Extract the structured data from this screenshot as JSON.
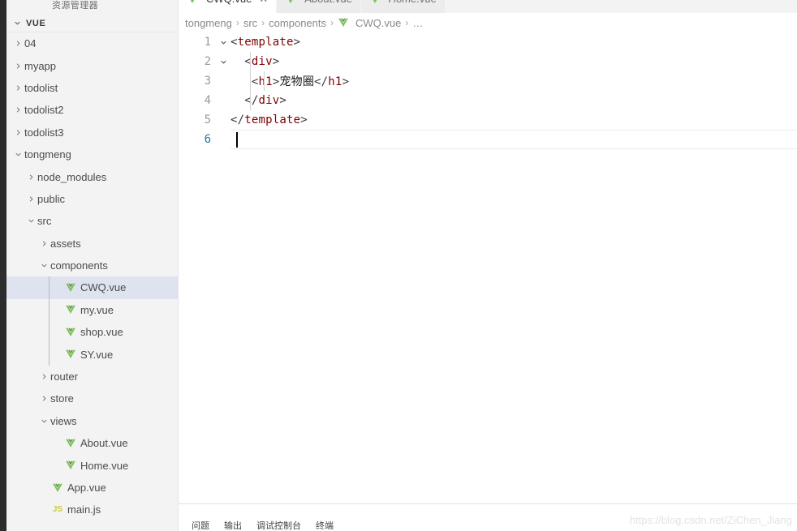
{
  "colors": {
    "activity_bar": "#2d2d2d",
    "sidebar_bg": "#f3f3f3",
    "selection": "#dfe2ef",
    "tab_inactive": "#ececec",
    "tab_active": "#ffffff",
    "vue_green": "#41b883",
    "vue_green_dark": "#80c25b",
    "js_yellow": "#cbcb41",
    "tag_name": "#800000",
    "line_number_active": "#237893"
  },
  "sidebar": {
    "title": "资源管理器",
    "section": {
      "label": "VUE",
      "twisty": "chevron-down-icon"
    },
    "items": [
      {
        "label": "04",
        "depth": 1,
        "twisty": "chevron-right-icon",
        "icon": "none",
        "selected": false
      },
      {
        "label": "myapp",
        "depth": 1,
        "twisty": "chevron-right-icon",
        "icon": "none",
        "selected": false
      },
      {
        "label": "todolist",
        "depth": 1,
        "twisty": "chevron-right-icon",
        "icon": "none",
        "selected": false
      },
      {
        "label": "todolist2",
        "depth": 1,
        "twisty": "chevron-right-icon",
        "icon": "none",
        "selected": false
      },
      {
        "label": "todolist3",
        "depth": 1,
        "twisty": "chevron-right-icon",
        "icon": "none",
        "selected": false
      },
      {
        "label": "tongmeng",
        "depth": 1,
        "twisty": "chevron-down-icon",
        "icon": "none",
        "selected": false
      },
      {
        "label": "node_modules",
        "depth": 2,
        "twisty": "chevron-right-icon",
        "icon": "none",
        "selected": false
      },
      {
        "label": "public",
        "depth": 2,
        "twisty": "chevron-right-icon",
        "icon": "none",
        "selected": false
      },
      {
        "label": "src",
        "depth": 2,
        "twisty": "chevron-down-icon",
        "icon": "none",
        "selected": false
      },
      {
        "label": "assets",
        "depth": 3,
        "twisty": "chevron-right-icon",
        "icon": "none",
        "selected": false
      },
      {
        "label": "components",
        "depth": 3,
        "twisty": "chevron-down-icon",
        "icon": "none",
        "selected": false
      },
      {
        "label": "CWQ.vue",
        "depth": 4,
        "twisty": "none",
        "icon": "vue-file-icon",
        "selected": true
      },
      {
        "label": "my.vue",
        "depth": 4,
        "twisty": "none",
        "icon": "vue-file-icon",
        "selected": false
      },
      {
        "label": "shop.vue",
        "depth": 4,
        "twisty": "none",
        "icon": "vue-file-icon",
        "selected": false
      },
      {
        "label": "SY.vue",
        "depth": 4,
        "twisty": "none",
        "icon": "vue-file-icon",
        "selected": false
      },
      {
        "label": "router",
        "depth": 3,
        "twisty": "chevron-right-icon",
        "icon": "none",
        "selected": false
      },
      {
        "label": "store",
        "depth": 3,
        "twisty": "chevron-right-icon",
        "icon": "none",
        "selected": false
      },
      {
        "label": "views",
        "depth": 3,
        "twisty": "chevron-down-icon",
        "icon": "none",
        "selected": false
      },
      {
        "label": "About.vue",
        "depth": 4,
        "twisty": "none",
        "icon": "vue-file-icon",
        "selected": false
      },
      {
        "label": "Home.vue",
        "depth": 4,
        "twisty": "none",
        "icon": "vue-file-icon",
        "selected": false
      },
      {
        "label": "App.vue",
        "depth": 3,
        "twisty": "none",
        "icon": "vue-file-icon",
        "selected": false
      },
      {
        "label": "main.js",
        "depth": 3,
        "twisty": "none",
        "icon": "js-file-icon",
        "selected": false
      }
    ]
  },
  "editor": {
    "tabs": [
      {
        "label": "CWQ.vue",
        "icon": "vue-file-icon",
        "active": true,
        "preview": false,
        "closable": true,
        "close_glyph": "✕"
      },
      {
        "label": "About.vue",
        "icon": "vue-file-icon",
        "active": false,
        "preview": false,
        "closable": false
      },
      {
        "label": "Home.vue",
        "icon": "vue-file-icon",
        "active": false,
        "preview": true,
        "closable": false
      }
    ],
    "breadcrumb": {
      "separator": "›",
      "crumbs": [
        "tongmeng",
        "src",
        "components"
      ],
      "file": "CWQ.vue",
      "file_icon": "vue-file-icon",
      "trailing": "…"
    },
    "lines": [
      {
        "num": "1",
        "fold": "chevron-down-icon",
        "indent": 0,
        "segments": [
          {
            "t": "<",
            "c": "tagbr"
          },
          {
            "t": "template",
            "c": "tagname"
          },
          {
            "t": ">",
            "c": "tagbr"
          }
        ]
      },
      {
        "num": "2",
        "fold": "chevron-down-icon",
        "indent": 2,
        "segments": [
          {
            "t": "  <",
            "c": "tagbr"
          },
          {
            "t": "div",
            "c": "tagname"
          },
          {
            "t": ">",
            "c": "tagbr"
          }
        ]
      },
      {
        "num": "3",
        "fold": "none",
        "indent": 4,
        "segments": [
          {
            "t": "   <",
            "c": "tagbr"
          },
          {
            "t": "h1",
            "c": "tagname"
          },
          {
            "t": ">",
            "c": "tagbr"
          },
          {
            "t": "宠物圈",
            "c": "plaintext"
          },
          {
            "t": "</",
            "c": "tagbr"
          },
          {
            "t": "h1",
            "c": "tagname"
          },
          {
            "t": ">",
            "c": "tagbr"
          }
        ]
      },
      {
        "num": "4",
        "fold": "none",
        "indent": 2,
        "segments": [
          {
            "t": "  </",
            "c": "tagbr"
          },
          {
            "t": "div",
            "c": "tagname"
          },
          {
            "t": ">",
            "c": "tagbr"
          }
        ]
      },
      {
        "num": "5",
        "fold": "none",
        "indent": 0,
        "segments": [
          {
            "t": "</",
            "c": "tagbr"
          },
          {
            "t": "template",
            "c": "tagname"
          },
          {
            "t": ">",
            "c": "tagbr"
          }
        ]
      },
      {
        "num": "6",
        "fold": "none",
        "indent": 0,
        "current": true,
        "segments": []
      }
    ]
  },
  "panel": {
    "tabs": [
      "问题",
      "输出",
      "调试控制台",
      "终端"
    ]
  },
  "watermark": "https://blog.csdn.net/ZiChen_Jiang"
}
